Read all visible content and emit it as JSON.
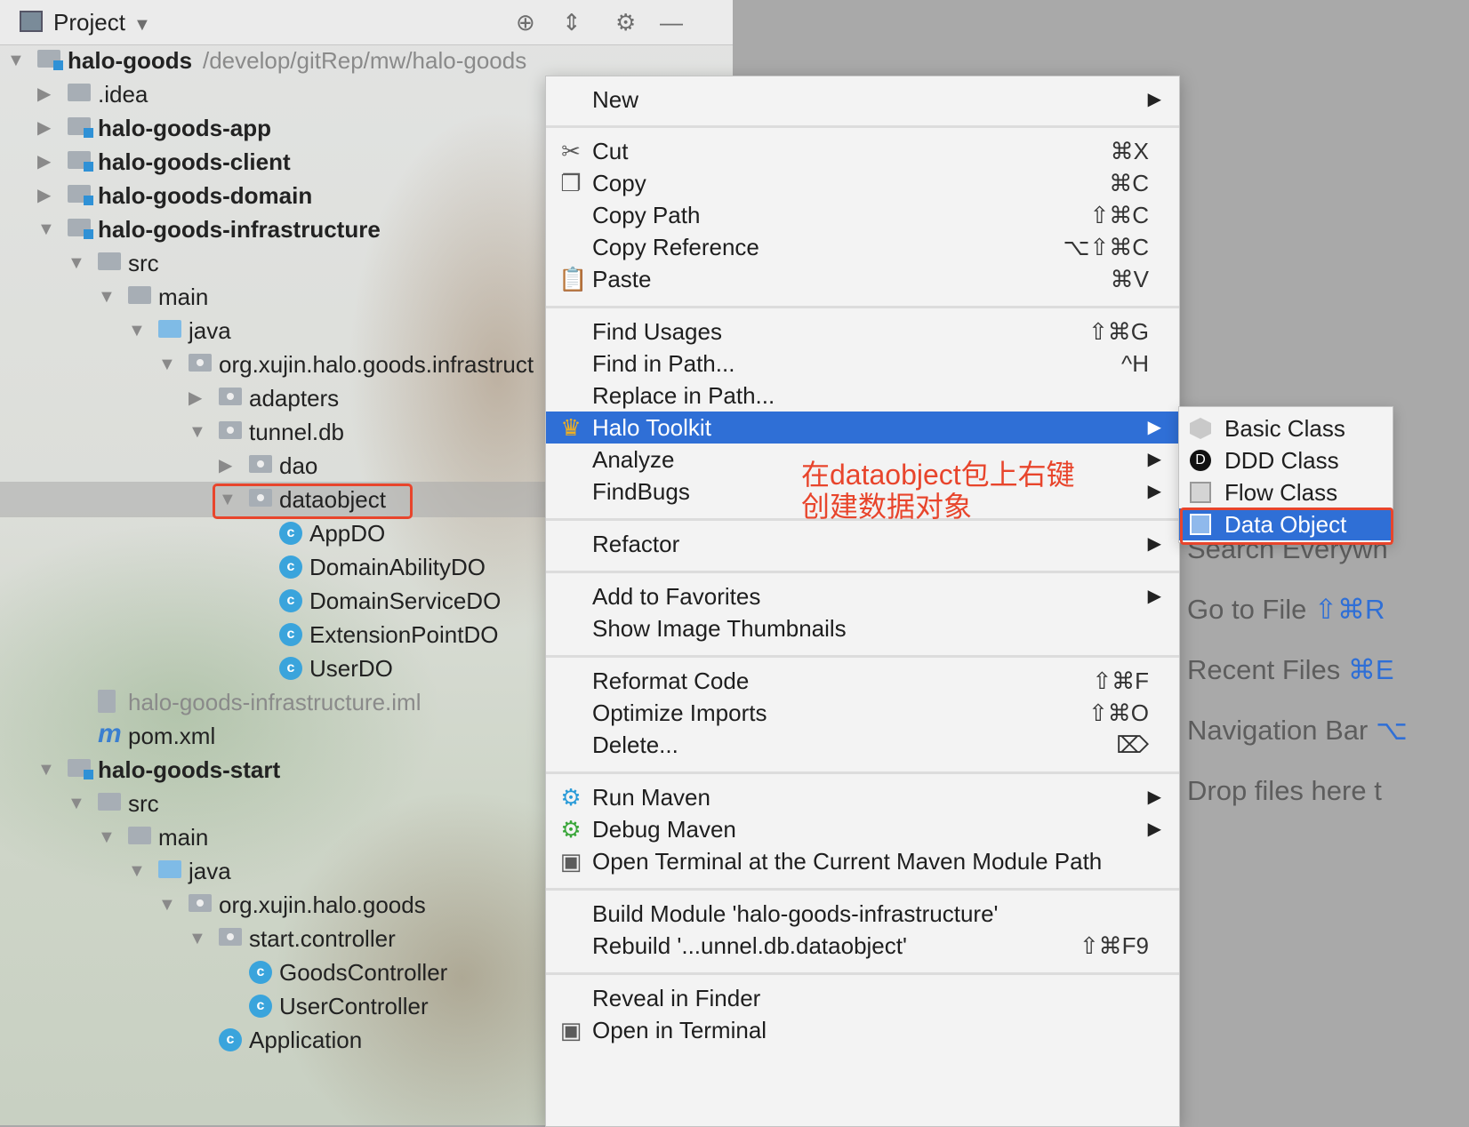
{
  "panel": {
    "title": "Project",
    "dropdown_icon": "chevron-down-icon",
    "icons": [
      "locate-icon",
      "collapse-all-icon",
      "gear-icon",
      "minimize-icon"
    ]
  },
  "tree": [
    {
      "label": "halo-goods",
      "path": "/develop/gitRep/mw/halo-goods"
    },
    {
      "label": ".idea"
    },
    {
      "label": "halo-goods-app"
    },
    {
      "label": "halo-goods-client"
    },
    {
      "label": "halo-goods-domain"
    },
    {
      "label": "halo-goods-infrastructure"
    },
    {
      "label": "src"
    },
    {
      "label": "main"
    },
    {
      "label": "java"
    },
    {
      "label": "org.xujin.halo.goods.infrastruct"
    },
    {
      "label": "adapters"
    },
    {
      "label": "tunnel.db"
    },
    {
      "label": "dao"
    },
    {
      "label": "dataobject"
    },
    {
      "label": "AppDO"
    },
    {
      "label": "DomainAbilityDO"
    },
    {
      "label": "DomainServiceDO"
    },
    {
      "label": "ExtensionPointDO"
    },
    {
      "label": "UserDO"
    },
    {
      "label": "halo-goods-infrastructure.iml"
    },
    {
      "label": "pom.xml"
    },
    {
      "label": "halo-goods-start"
    },
    {
      "label": "src"
    },
    {
      "label": "main"
    },
    {
      "label": "java"
    },
    {
      "label": "org.xujin.halo.goods"
    },
    {
      "label": "start.controller"
    },
    {
      "label": "GoodsController"
    },
    {
      "label": "UserController"
    },
    {
      "label": "Application"
    }
  ],
  "class_icon_letter": "c",
  "menu": [
    {
      "label": "New",
      "submenu": true
    },
    {
      "label": "Cut",
      "shortcut": "⌘X",
      "icon": "scissors-icon"
    },
    {
      "label": "Copy",
      "shortcut": "⌘C",
      "icon": "copy-icon"
    },
    {
      "label": "Copy Path",
      "shortcut": "⇧⌘C"
    },
    {
      "label": "Copy Reference",
      "shortcut": "⌥⇧⌘C"
    },
    {
      "label": "Paste",
      "shortcut": "⌘V",
      "icon": "clipboard-icon"
    },
    {
      "label": "Find Usages",
      "shortcut": "⇧⌘G"
    },
    {
      "label": "Find in Path...",
      "shortcut": "^H"
    },
    {
      "label": "Replace in Path..."
    },
    {
      "label": "Halo Toolkit",
      "submenu": true,
      "icon": "crown-icon",
      "active": true
    },
    {
      "label": "Analyze",
      "submenu": true
    },
    {
      "label": "FindBugs",
      "submenu": true
    },
    {
      "label": "Refactor",
      "submenu": true
    },
    {
      "label": "Add to Favorites",
      "submenu": true
    },
    {
      "label": "Show Image Thumbnails"
    },
    {
      "label": "Reformat Code",
      "shortcut": "⇧⌘F"
    },
    {
      "label": "Optimize Imports",
      "shortcut": "⇧⌘O"
    },
    {
      "label": "Delete...",
      "shortcut": "⌦"
    },
    {
      "label": "Run Maven",
      "submenu": true,
      "icon": "maven-gear-icon"
    },
    {
      "label": "Debug Maven",
      "submenu": true,
      "icon": "maven-debug-icon"
    },
    {
      "label": "Open Terminal at the Current Maven Module Path",
      "icon": "terminal-icon"
    },
    {
      "label": "Build Module 'halo-goods-infrastructure'"
    },
    {
      "label": "Rebuild '...unnel.db.dataobject'",
      "shortcut": "⇧⌘F9"
    },
    {
      "label": "Reveal in Finder"
    },
    {
      "label": "Open in Terminal",
      "icon": "terminal-icon"
    }
  ],
  "submenu": [
    {
      "label": "Basic Class",
      "icon": "basic-class-icon"
    },
    {
      "label": "DDD Class",
      "icon": "ddd-class-icon"
    },
    {
      "label": "Flow Class",
      "icon": "flow-class-icon"
    },
    {
      "label": "Data Object",
      "icon": "data-object-icon",
      "active": true
    }
  ],
  "annotation": "在dataobject包上右键\n创建数据对象",
  "editor_hints": [
    {
      "label": "Search Everywh"
    },
    {
      "label": "Go to File",
      "key": "⇧⌘R"
    },
    {
      "label": "Recent Files",
      "key": "⌘E"
    },
    {
      "label": "Navigation Bar",
      "key": "⌥"
    },
    {
      "label": "Drop files here t"
    }
  ],
  "colors": {
    "selection": "#2f6fd6",
    "highlight_box": "#e8452c",
    "class_icon": "#3aa4dc"
  }
}
